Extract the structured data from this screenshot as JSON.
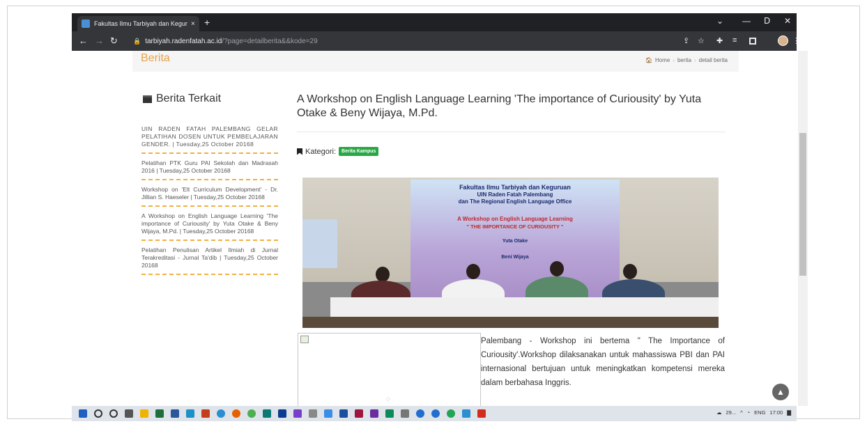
{
  "browser": {
    "tab_title": "Fakultas Ilmu Tarbiyah dan Kegur",
    "tab_close": "×",
    "new_tab": "+",
    "url_host": "tarbiyah.radenfatah.ac.id",
    "url_path": "/?page=detailberita&&kode=29",
    "window_controls": {
      "minimize": "—",
      "restore": "ᗞ",
      "close": "✕",
      "dropdown": "⌄"
    },
    "icons": [
      "back-icon",
      "forward-icon",
      "reload-icon",
      "lock-icon",
      "share-icon",
      "star-icon",
      "extensions-icon",
      "reading-list-icon",
      "sidepanel-icon",
      "profile-avatar",
      "menu-icon"
    ]
  },
  "page_header": {
    "title": "Berita",
    "breadcrumb": [
      "Home",
      "berita",
      "detail berita"
    ]
  },
  "sidebar": {
    "title": "Berita Terkait",
    "items": [
      "UIN RADEN FATAH PALEMBANG GELAR PELATIHAN DOSEN UNTUK PEMBELAJARAN GENDER. | Tuesday,25 October 20168",
      "Pelatihan PTK Guru PAI Sekolah dan Madrasah 2016 | Tuesday,25 October 20168",
      "Workshop on 'Elt Curriculum Development' - Dr. Jillian S. Haeseler | Tuesday,25 October 20168",
      "A Workshop on English Language Learning 'The importance of Curiousity' by Yuta Otake & Beny Wijaya, M.Pd. | Tuesday,25 October 20168",
      "Pelatihan Penulisan Artikel Ilmiah di Jurnal Terakreditasi - Jurnal Ta'dib | Tuesday,25 October 20168"
    ]
  },
  "article": {
    "title": "A Workshop on English Language Learning 'The importance of Curiousity' by Yuta Otake & Beny Wijaya, M.Pd.",
    "kategori_label": "Kategori:",
    "kategori_value": "Berita Kampus",
    "photo_banner": {
      "line1": "Fakultas Ilmu Tarbiyah dan Keguruan",
      "line2": "UIN Raden Fatah Palembang",
      "line3": "dan The Regional English Language Office",
      "line4": "A Workshop on English Language Learning",
      "line5": "\" THE IMPORTANCE OF CURIOUSITY \"",
      "line6": "Yuta Otake",
      "line7": "Beni Wijaya"
    },
    "body": "Palembang - Workshop ini bertema \" The Importance of Curiousity'.Workshop dilaksanakan untuk mahassiswa PBI dan PAI internasional bertujuan untuk meningkatkan kompetensi mereka dalam berbahasa Inggris."
  },
  "taskbar": {
    "tray_text": [
      "29...",
      "ENG",
      "17:00"
    ]
  },
  "colors": {
    "accent_orange": "#e8a14a",
    "badge_green": "#28a745",
    "chrome_dark": "#202124",
    "chrome_bar": "#35363a"
  }
}
